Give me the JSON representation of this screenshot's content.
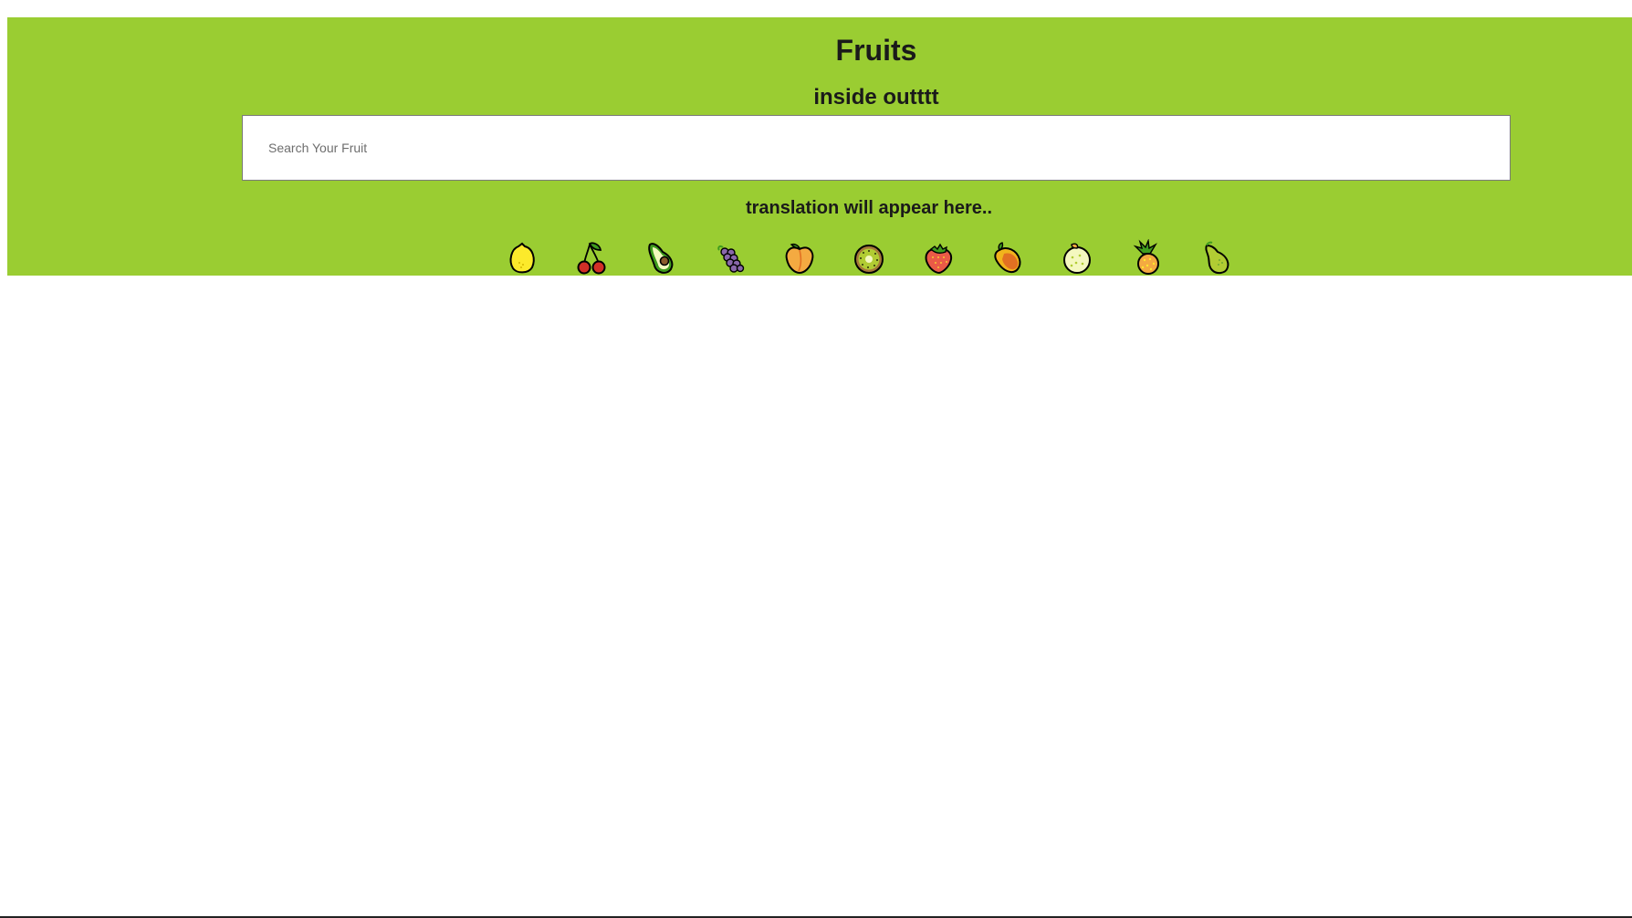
{
  "header": {
    "title": "Fruits",
    "subtitle": "inside outttt",
    "background_color": "#9acd32"
  },
  "search": {
    "placeholder": "Search Your Fruit",
    "value": ""
  },
  "output": {
    "translation_text": "translation will appear here.."
  },
  "fruits": [
    {
      "name": "lemon-icon"
    },
    {
      "name": "cherries-icon"
    },
    {
      "name": "avocado-icon"
    },
    {
      "name": "grapes-icon"
    },
    {
      "name": "peach-icon"
    },
    {
      "name": "kiwi-icon"
    },
    {
      "name": "strawberry-icon"
    },
    {
      "name": "mango-icon"
    },
    {
      "name": "melon-icon"
    },
    {
      "name": "pineapple-icon"
    },
    {
      "name": "pear-icon"
    }
  ]
}
